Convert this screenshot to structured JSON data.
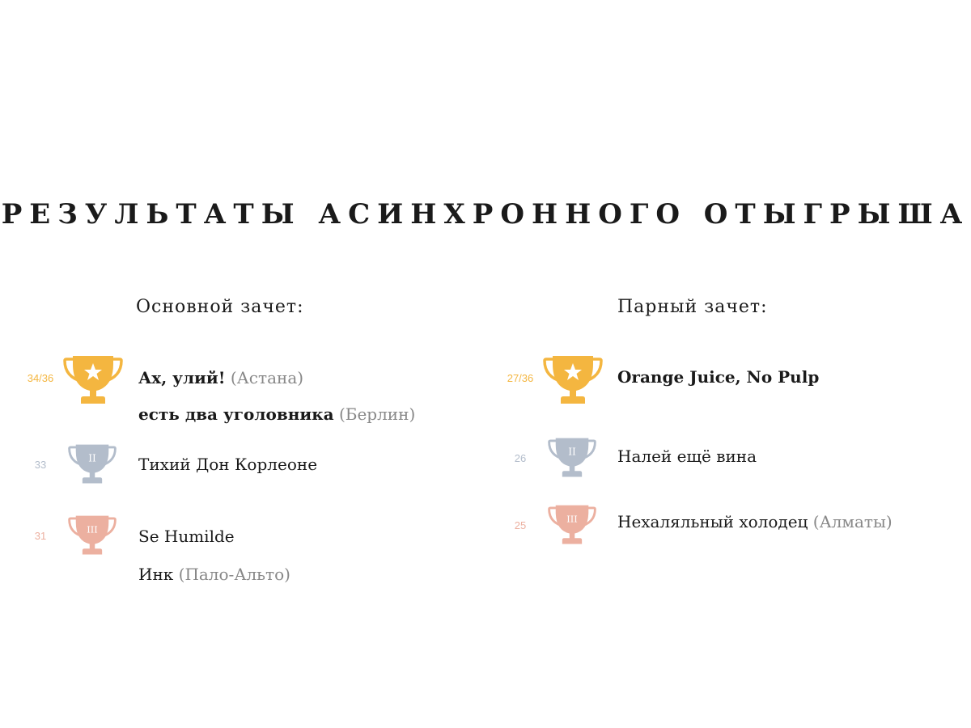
{
  "title": "РЕЗУЛЬТАТЫ АСИНХРОННОГО ОТЫГРЫША",
  "colors": {
    "gold": "#F4B640",
    "silver": "#B3BDCB",
    "bronze": "#ECB0A0",
    "text": "#1a1a1a",
    "city": "#888888"
  },
  "main": {
    "heading": "Основной зачет:",
    "places": [
      {
        "rank": "gold",
        "trophy_icon": "trophy-star-icon",
        "score": "34/36",
        "teams": [
          {
            "name": "Ах, улий!",
            "city": "(Астана)"
          },
          {
            "name": "есть два уголовника",
            "city": "(Берлин)"
          }
        ]
      },
      {
        "rank": "silver",
        "trophy_icon": "trophy-roman-2-icon",
        "roman": "II",
        "score": "33",
        "teams": [
          {
            "name": "Тихий Дон Корлеоне",
            "city": ""
          }
        ]
      },
      {
        "rank": "bronze",
        "trophy_icon": "trophy-roman-3-icon",
        "roman": "III",
        "score": "31",
        "teams": [
          {
            "name": "Se Humilde",
            "city": ""
          },
          {
            "name": "Инк",
            "city": "(Пало-Альто)"
          }
        ]
      }
    ]
  },
  "pairs": {
    "heading": "Парный зачет:",
    "places": [
      {
        "rank": "gold",
        "trophy_icon": "trophy-star-icon",
        "score": "27/36",
        "teams": [
          {
            "name": "Orange Juice, No Pulp",
            "city": ""
          }
        ]
      },
      {
        "rank": "silver",
        "trophy_icon": "trophy-roman-2-icon",
        "roman": "II",
        "score": "26",
        "teams": [
          {
            "name": "Налей ещё вина",
            "city": ""
          }
        ]
      },
      {
        "rank": "bronze",
        "trophy_icon": "trophy-roman-3-icon",
        "roman": "III",
        "score": "25",
        "teams": [
          {
            "name": "Нехаляльный холодец",
            "city": "(Алматы)"
          }
        ]
      }
    ]
  }
}
